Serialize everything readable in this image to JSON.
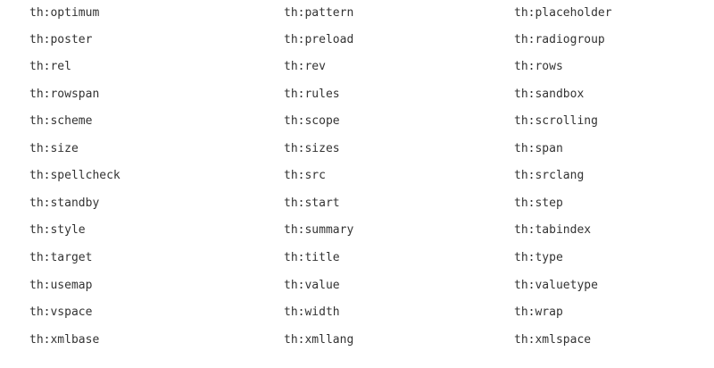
{
  "rows": [
    [
      "th:optimum",
      "th:pattern",
      "th:placeholder"
    ],
    [
      "th:poster",
      "th:preload",
      "th:radiogroup"
    ],
    [
      "th:rel",
      "th:rev",
      "th:rows"
    ],
    [
      "th:rowspan",
      "th:rules",
      "th:sandbox"
    ],
    [
      "th:scheme",
      "th:scope",
      "th:scrolling"
    ],
    [
      "th:size",
      "th:sizes",
      "th:span"
    ],
    [
      "th:spellcheck",
      "th:src",
      "th:srclang"
    ],
    [
      "th:standby",
      "th:start",
      "th:step"
    ],
    [
      "th:style",
      "th:summary",
      "th:tabindex"
    ],
    [
      "th:target",
      "th:title",
      "th:type"
    ],
    [
      "th:usemap",
      "th:value",
      "th:valuetype"
    ],
    [
      "th:vspace",
      "th:width",
      "th:wrap"
    ],
    [
      "th:xmlbase",
      "th:xmllang",
      "th:xmlspace"
    ]
  ]
}
